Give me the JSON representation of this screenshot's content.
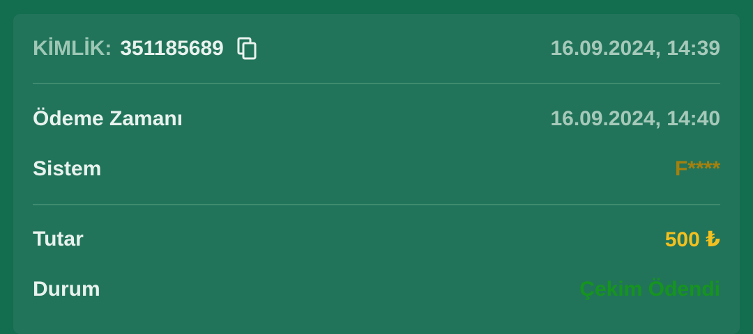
{
  "header": {
    "id_label": "KİMLİK:",
    "id_value": "351185689",
    "created_at": "16.09.2024, 14:39"
  },
  "details": {
    "payment_time_label": "Ödeme Zamanı",
    "payment_time_value": "16.09.2024, 14:40",
    "system_label": "Sistem",
    "system_value": "F****"
  },
  "summary": {
    "amount_label": "Tutar",
    "amount_value": "500 ₺",
    "status_label": "Durum",
    "status_value": "Çekim Ödendi"
  },
  "icons": {
    "copy": "copy-icon"
  },
  "colors": {
    "background": "#136d4f",
    "card": "#21745a",
    "amount": "#f3c01f",
    "status": "#16941f",
    "system": "#a5800f"
  }
}
